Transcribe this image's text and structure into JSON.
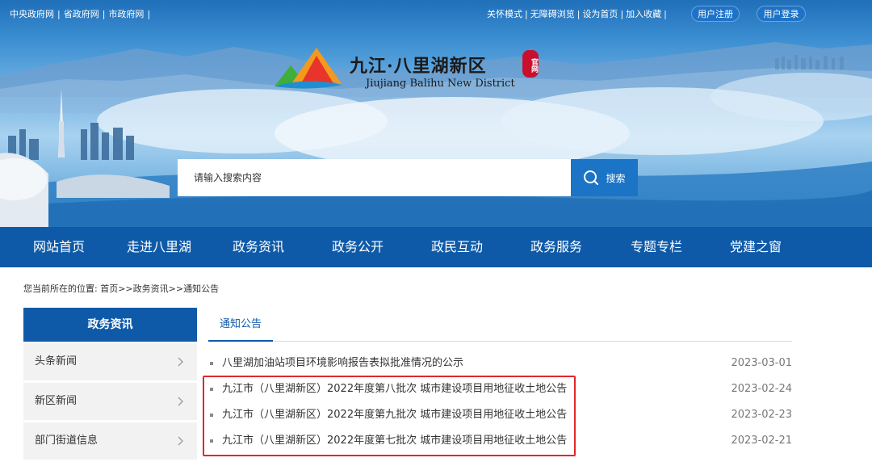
{
  "topbar": {
    "left_links": [
      "中央政府网",
      "省政府网",
      "市政府网"
    ],
    "right_links": [
      "关怀模式",
      "无障碍浏览",
      "设为首页",
      "加入收藏"
    ],
    "register_label": "用户注册",
    "login_label": "用户登录"
  },
  "logo": {
    "title_cn": "九江·八里湖新区",
    "title_en": "Jiujiang Balihu New District",
    "seal_text": "官网"
  },
  "search": {
    "placeholder": "请输入搜索内容",
    "button_label": "搜索",
    "icon": "search-icon"
  },
  "nav": {
    "items": [
      "网站首页",
      "走进八里湖",
      "政务资讯",
      "政务公开",
      "政民互动",
      "政务服务",
      "专题专栏",
      "党建之窗"
    ]
  },
  "breadcrumb": {
    "text": "您当前所在的位置: 首页>>政务资讯>>通知公告"
  },
  "sidebar": {
    "title": "政务资讯",
    "items": [
      {
        "label": "头条新闻",
        "icon": "chevron-right-icon"
      },
      {
        "label": "新区新闻",
        "icon": "chevron-right-icon"
      },
      {
        "label": "部门街道信息",
        "icon": "chevron-right-icon"
      }
    ]
  },
  "content": {
    "tab_label": "通知公告",
    "items": [
      {
        "title": "八里湖加油站项目环境影响报告表拟批准情况的公示",
        "date": "2023-03-01"
      },
      {
        "title": "九江市（八里湖新区）2022年度第八批次 城市建设项目用地征收土地公告",
        "date": "2023-02-24"
      },
      {
        "title": "九江市（八里湖新区）2022年度第九批次 城市建设项目用地征收土地公告",
        "date": "2023-02-23"
      },
      {
        "title": "九江市（八里湖新区）2022年度第七批次 城市建设项目用地征收土地公告",
        "date": "2023-02-21"
      }
    ]
  },
  "colors": {
    "nav_bg": "#0f5aa8",
    "search_button": "#1b74c5",
    "highlight": "#e3262b",
    "sidebar_item_bg": "#f2f2f2"
  }
}
